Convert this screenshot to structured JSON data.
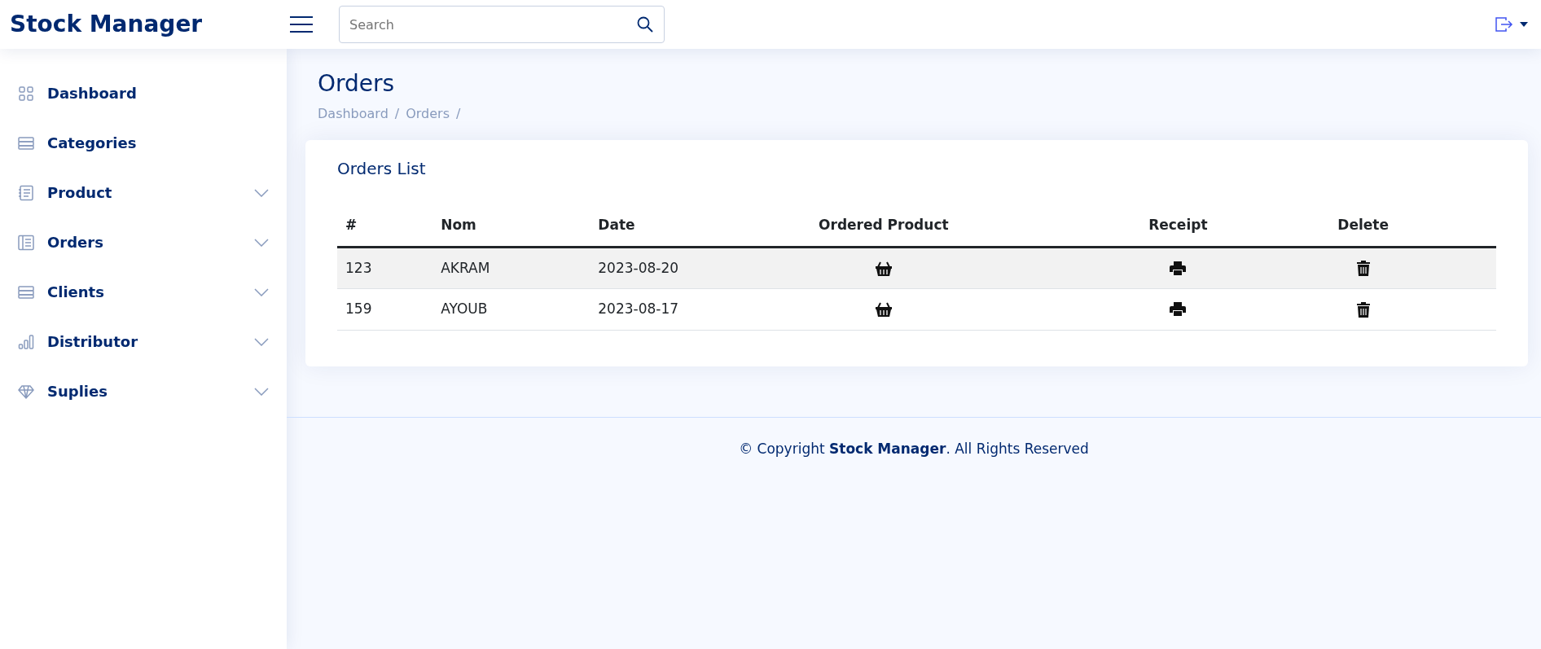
{
  "header": {
    "brand": "Stock Manager",
    "search": {
      "placeholder": "Search"
    }
  },
  "sidebar": {
    "items": [
      {
        "label": "Dashboard",
        "expandable": false
      },
      {
        "label": "Categories",
        "expandable": false
      },
      {
        "label": "Product",
        "expandable": true
      },
      {
        "label": "Orders",
        "expandable": true
      },
      {
        "label": "Clients",
        "expandable": true
      },
      {
        "label": "Distributor",
        "expandable": true
      },
      {
        "label": "Suplies",
        "expandable": true
      }
    ]
  },
  "page": {
    "title": "Orders",
    "breadcrumb": [
      {
        "label": "Dashboard",
        "separator": "/"
      },
      {
        "label": "Orders",
        "separator": "/"
      }
    ]
  },
  "card": {
    "title": "Orders List",
    "table": {
      "columns": [
        "#",
        "Nom",
        "Date",
        "Ordered Product",
        "Receipt",
        "Delete"
      ],
      "rows": [
        {
          "id": "123",
          "name": "AKRAM",
          "date": "2023-08-20"
        },
        {
          "id": "159",
          "name": "AYOUB",
          "date": "2023-08-17"
        }
      ]
    }
  },
  "footer": {
    "text": "© Copyright **Stock Manager**. All Rights Reserved"
  }
}
